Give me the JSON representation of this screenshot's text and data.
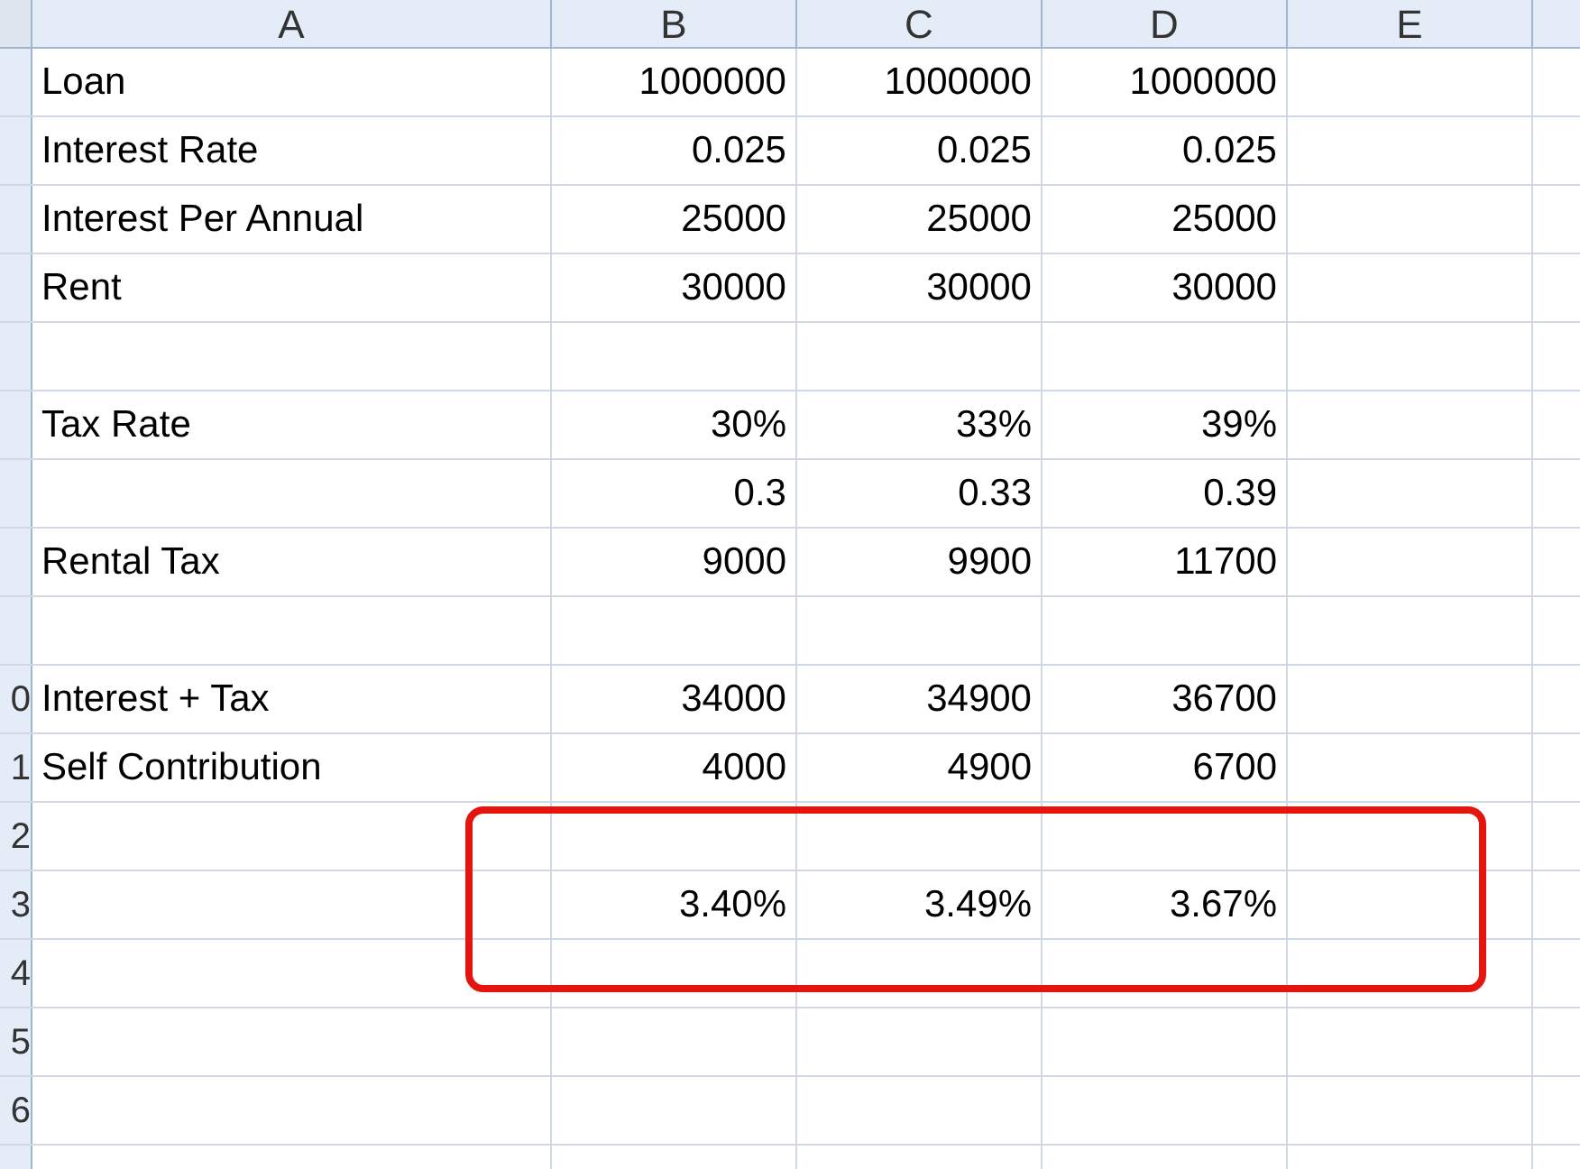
{
  "columns": [
    "A",
    "B",
    "C",
    "D",
    "E"
  ],
  "rows": [
    {
      "cells": [
        "Loan",
        "1000000",
        "1000000",
        "1000000",
        ""
      ]
    },
    {
      "cells": [
        "Interest Rate",
        "0.025",
        "0.025",
        "0.025",
        ""
      ]
    },
    {
      "cells": [
        "Interest Per Annual",
        "25000",
        "25000",
        "25000",
        ""
      ]
    },
    {
      "cells": [
        "Rent",
        "30000",
        "30000",
        "30000",
        ""
      ]
    },
    {
      "cells": [
        "",
        "",
        "",
        "",
        ""
      ]
    },
    {
      "cells": [
        "Tax Rate",
        "30%",
        "33%",
        "39%",
        ""
      ]
    },
    {
      "cells": [
        "",
        "0.3",
        "0.33",
        "0.39",
        ""
      ]
    },
    {
      "cells": [
        "Rental Tax",
        "9000",
        "9900",
        "11700",
        ""
      ]
    },
    {
      "cells": [
        "",
        "",
        "",
        "",
        ""
      ]
    },
    {
      "number": "0",
      "cells": [
        "Interest + Tax",
        "34000",
        "34900",
        "36700",
        ""
      ]
    },
    {
      "number": "1",
      "cells": [
        "Self Contribution",
        "4000",
        "4900",
        "6700",
        ""
      ]
    },
    {
      "number": "2",
      "cells": [
        "",
        "",
        "",
        "",
        ""
      ]
    },
    {
      "number": "3",
      "cells": [
        "",
        "3.40%",
        "3.49%",
        "3.67%",
        ""
      ]
    },
    {
      "number": "4",
      "cells": [
        "",
        "",
        "",
        "",
        ""
      ]
    },
    {
      "number": "5",
      "cells": [
        "",
        "",
        "",
        "",
        ""
      ]
    },
    {
      "number": "6",
      "cells": [
        "",
        "",
        "",
        "",
        ""
      ]
    }
  ]
}
